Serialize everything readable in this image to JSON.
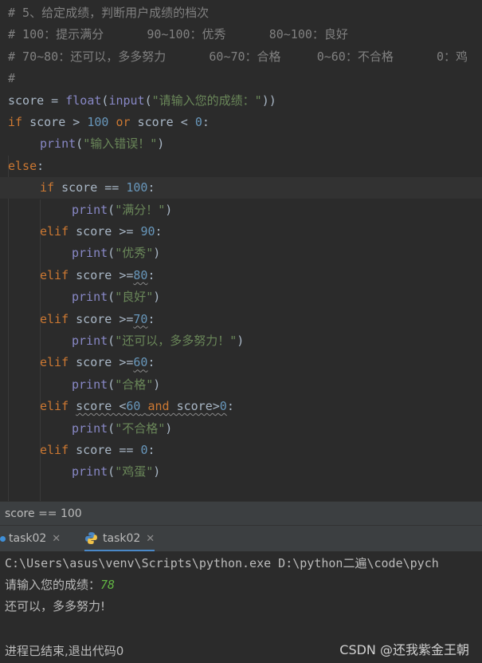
{
  "editor": {
    "lines": [
      {
        "segments": [
          {
            "t": "# 5、给定成绩，判断用户成绩的档次",
            "c": "cmt"
          }
        ]
      },
      {
        "segments": [
          {
            "t": "# 100：提示满分      90~100：优秀      80~100：良好",
            "c": "cmt"
          }
        ]
      },
      {
        "segments": [
          {
            "t": "# 70~80：还可以，多多努力      60~70：合格     0~60：不合格      0：鸡",
            "c": "cmt"
          }
        ]
      },
      {
        "segments": [
          {
            "t": "#",
            "c": "cmt"
          }
        ]
      },
      {
        "segments": [
          {
            "t": "score",
            "c": "var"
          },
          {
            "t": " = ",
            "c": "var"
          },
          {
            "t": "float",
            "c": "fn"
          },
          {
            "t": "(",
            "c": "var"
          },
          {
            "t": "input",
            "c": "fn"
          },
          {
            "t": "(",
            "c": "var"
          },
          {
            "t": "\"请输入您的成绩：\"",
            "c": "str"
          },
          {
            "t": "))",
            "c": "var"
          }
        ]
      },
      {
        "segments": [
          {
            "t": "if",
            "c": "kw"
          },
          {
            "t": " score > ",
            "c": "var"
          },
          {
            "t": "100",
            "c": "num"
          },
          {
            "t": " ",
            "c": "var"
          },
          {
            "t": "or",
            "c": "kw"
          },
          {
            "t": " score < ",
            "c": "var"
          },
          {
            "t": "0",
            "c": "num"
          },
          {
            "t": ":",
            "c": "var"
          }
        ]
      },
      {
        "indent": 1,
        "segments": [
          {
            "t": "print",
            "c": "fn"
          },
          {
            "t": "(",
            "c": "var"
          },
          {
            "t": "\"输入错误！\"",
            "c": "str"
          },
          {
            "t": ")",
            "c": "var"
          }
        ]
      },
      {
        "segments": [
          {
            "t": "else",
            "c": "kw"
          },
          {
            "t": ":",
            "c": "var"
          }
        ]
      },
      {
        "indent": 1,
        "current": true,
        "segments": [
          {
            "t": "if",
            "c": "kw"
          },
          {
            "t": " score == ",
            "c": "var"
          },
          {
            "t": "100",
            "c": "num"
          },
          {
            "t": ":",
            "c": "var"
          }
        ]
      },
      {
        "indent": 2,
        "segments": [
          {
            "t": "print",
            "c": "fn"
          },
          {
            "t": "(",
            "c": "var"
          },
          {
            "t": "\"满分！\"",
            "c": "str"
          },
          {
            "t": ")",
            "c": "var"
          }
        ]
      },
      {
        "indent": 1,
        "segments": [
          {
            "t": "elif",
            "c": "kw"
          },
          {
            "t": " score >= ",
            "c": "var"
          },
          {
            "t": "90",
            "c": "num"
          },
          {
            "t": ":",
            "c": "var"
          }
        ]
      },
      {
        "indent": 2,
        "segments": [
          {
            "t": "print",
            "c": "fn"
          },
          {
            "t": "(",
            "c": "var"
          },
          {
            "t": "\"优秀\"",
            "c": "str"
          },
          {
            "t": ")",
            "c": "var"
          }
        ]
      },
      {
        "indent": 1,
        "segments": [
          {
            "t": "elif",
            "c": "kw"
          },
          {
            "t": " score >=",
            "c": "var"
          },
          {
            "t": "80",
            "c": "num wavy"
          },
          {
            "t": ":",
            "c": "var"
          }
        ]
      },
      {
        "indent": 2,
        "segments": [
          {
            "t": "print",
            "c": "fn"
          },
          {
            "t": "(",
            "c": "var"
          },
          {
            "t": "\"良好\"",
            "c": "str"
          },
          {
            "t": ")",
            "c": "var"
          }
        ]
      },
      {
        "indent": 1,
        "segments": [
          {
            "t": "elif",
            "c": "kw"
          },
          {
            "t": " score >=",
            "c": "var"
          },
          {
            "t": "70",
            "c": "num wavy"
          },
          {
            "t": ":",
            "c": "var"
          }
        ]
      },
      {
        "indent": 2,
        "segments": [
          {
            "t": "print",
            "c": "fn"
          },
          {
            "t": "(",
            "c": "var"
          },
          {
            "t": "\"还可以，多多努力！\"",
            "c": "str"
          },
          {
            "t": ")",
            "c": "var"
          }
        ]
      },
      {
        "indent": 1,
        "segments": [
          {
            "t": "elif",
            "c": "kw"
          },
          {
            "t": " score >=",
            "c": "var"
          },
          {
            "t": "60",
            "c": "num wavy"
          },
          {
            "t": ":",
            "c": "var"
          }
        ]
      },
      {
        "indent": 2,
        "segments": [
          {
            "t": "print",
            "c": "fn"
          },
          {
            "t": "(",
            "c": "var"
          },
          {
            "t": "\"合格\"",
            "c": "str"
          },
          {
            "t": ")",
            "c": "var"
          }
        ]
      },
      {
        "indent": 1,
        "segments": [
          {
            "t": "elif",
            "c": "kw"
          },
          {
            "t": " ",
            "c": "var"
          },
          {
            "t": "score <",
            "c": "var wavy"
          },
          {
            "t": "60",
            "c": "num wavy"
          },
          {
            "t": " ",
            "c": "var wavy"
          },
          {
            "t": "and",
            "c": "kw wavy"
          },
          {
            "t": " score>",
            "c": "var wavy"
          },
          {
            "t": "0",
            "c": "num wavy"
          },
          {
            "t": ":",
            "c": "var"
          }
        ]
      },
      {
        "indent": 2,
        "segments": [
          {
            "t": "print",
            "c": "fn"
          },
          {
            "t": "(",
            "c": "var"
          },
          {
            "t": "\"不合格\"",
            "c": "str"
          },
          {
            "t": ")",
            "c": "var"
          }
        ]
      },
      {
        "indent": 1,
        "segments": [
          {
            "t": "elif",
            "c": "kw"
          },
          {
            "t": " score == ",
            "c": "var"
          },
          {
            "t": "0",
            "c": "num"
          },
          {
            "t": ":",
            "c": "var"
          }
        ]
      },
      {
        "indent": 2,
        "segments": [
          {
            "t": "print",
            "c": "fn"
          },
          {
            "t": "(",
            "c": "var"
          },
          {
            "t": "\"鸡蛋\"",
            "c": "str"
          },
          {
            "t": ")",
            "c": "var"
          }
        ]
      },
      {
        "segments": []
      }
    ]
  },
  "breadcrumb": {
    "text": "score == 100"
  },
  "tabs": [
    {
      "label": "task02",
      "close": "✕"
    },
    {
      "label": "task02",
      "close": "✕"
    }
  ],
  "console": {
    "command": "C:\\Users\\asus\\venv\\Scripts\\python.exe D:\\python二遍\\code\\pych",
    "prompt": "请输入您的成绩：",
    "input_value": "78",
    "output": "还可以，多多努力!",
    "exit": "进程已结束,退出代码0"
  },
  "watermark": "CSDN @还我紫金王朝",
  "colors": {
    "accent": "#4a88c7",
    "comment": "#808080",
    "keyword": "#cc7832",
    "number": "#6897bb",
    "string": "#6a8759",
    "builtin": "#8888c6"
  }
}
